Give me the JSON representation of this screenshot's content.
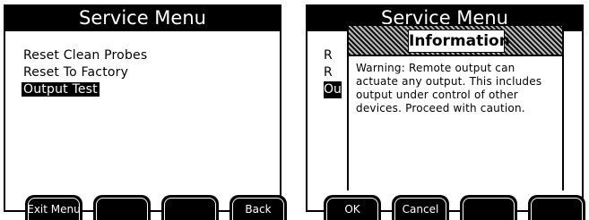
{
  "left_screen": {
    "title": "Service Menu",
    "menu_items": [
      {
        "label": "Reset Clean Probes",
        "selected": false
      },
      {
        "label": "Reset To Factory",
        "selected": false
      },
      {
        "label": "Output Test",
        "selected": true
      }
    ],
    "softkeys": [
      "Exit Menu",
      "",
      "",
      "Back"
    ]
  },
  "right_screen": {
    "title": "Service Menu",
    "peek_items": [
      "R",
      "R",
      "Ou"
    ],
    "dialog": {
      "title": "Information",
      "message": "Warning: Remote output can actuate any output. This includes output under control of other devices. Proceed with caution."
    },
    "softkeys": [
      "OK",
      "Cancel",
      "",
      ""
    ]
  }
}
